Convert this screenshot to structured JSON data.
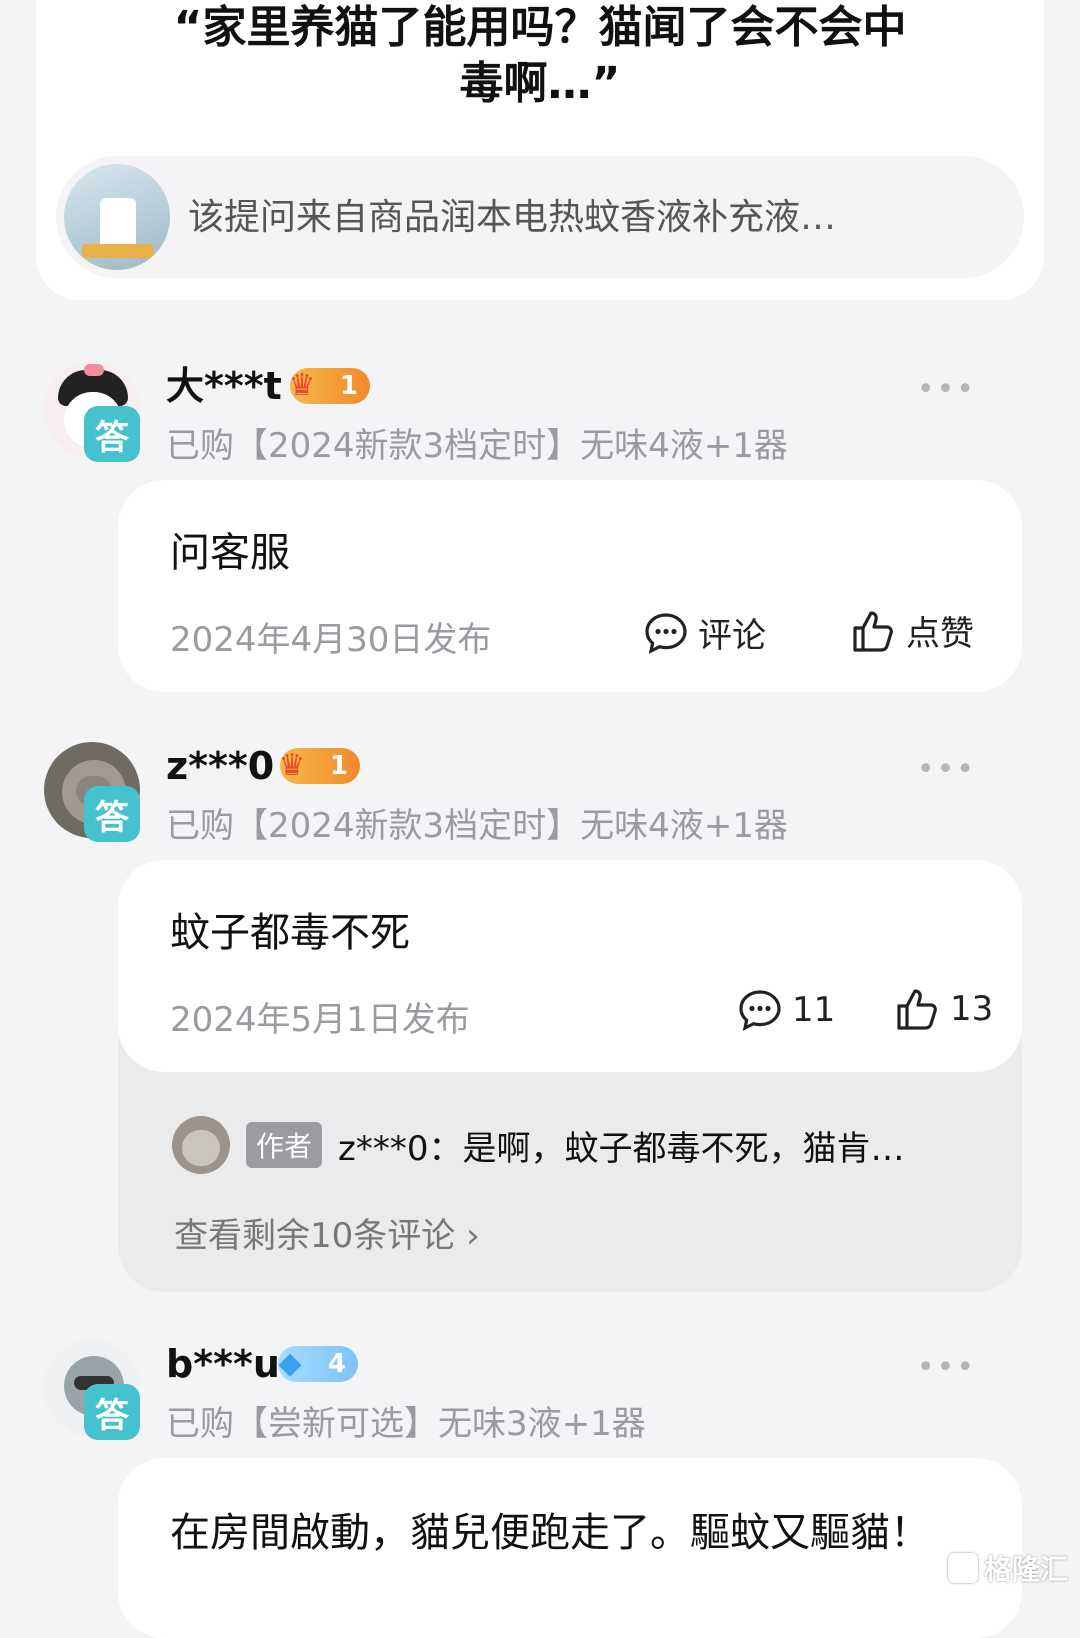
{
  "question": {
    "title": "“家里养猫了能用吗？猫闻了会不会中毒啊…”",
    "source_text": "该提问来自商品润本电热蚊香液补充液…"
  },
  "answers": [
    {
      "username": "大***t",
      "level": "1",
      "level_color": "#f08a2c",
      "badge": "答",
      "bought": "已购【2024新款3档定时】无味4液+1器",
      "content": "问客服",
      "date": "2024年4月30日发布",
      "comment_label": "评论",
      "like_label": "点赞"
    },
    {
      "username": "z***0",
      "level": "1",
      "level_color": "#f08a2c",
      "badge": "答",
      "bought": "已购【2024新款3档定时】无味4液+1器",
      "content": "蚊子都毒不死",
      "date": "2024年5月1日发布",
      "comment_label": "11",
      "like_label": "13",
      "reply": {
        "author_tag": "作者",
        "text": "z***0：是啊，蚊子都毒不死，猫肯…"
      },
      "view_more": "查看剩余10条评论 ›"
    },
    {
      "username": "b***u",
      "level": "4",
      "level_color": "#7cc3f7",
      "badge": "答",
      "bought": "已购【尝新可选】无味3液+1器",
      "content": "在房間啟動，貓兒便跑走了。驅蚊又驅貓！"
    }
  ],
  "more_icon": "•••",
  "watermark": "格隆汇"
}
